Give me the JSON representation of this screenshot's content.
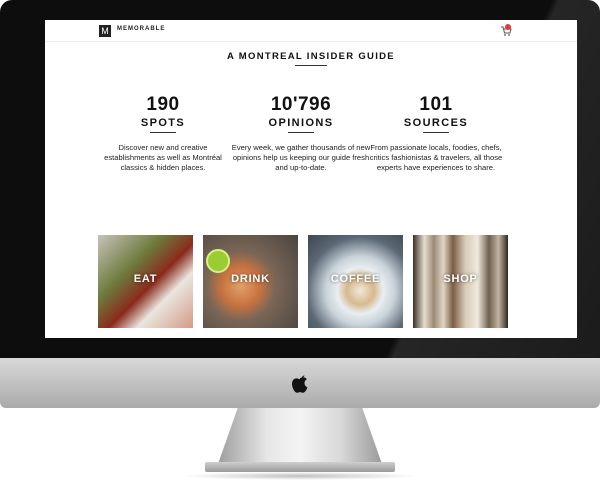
{
  "header": {
    "brand": "MEMORABLE",
    "logo_glyph": "M"
  },
  "main": {
    "title": "A MONTREAL INSIDER GUIDE",
    "stats": [
      {
        "number": "190",
        "label": "SPOTS",
        "description": "Discover new and creative establishments as well as Montréal classics & hidden places."
      },
      {
        "number": "10'796",
        "label": "OPINIONS",
        "description": "Every week, we gather thousands of new opinions help us keeping our guide fresh and up-to-date."
      },
      {
        "number": "101",
        "label": "SOURCES",
        "description": "From passionate locals, foodies, chefs, critics fashionistas & travelers, all those experts have experiences to share."
      }
    ],
    "categories": [
      {
        "label": "EAT"
      },
      {
        "label": "DRINK"
      },
      {
        "label": "COFFEE"
      },
      {
        "label": "SHOP"
      }
    ]
  },
  "colors": {
    "cart_badge": "#e53935",
    "text": "#111111"
  },
  "icons": [
    "logo-icon",
    "cart-icon",
    "apple-logo-icon"
  ]
}
